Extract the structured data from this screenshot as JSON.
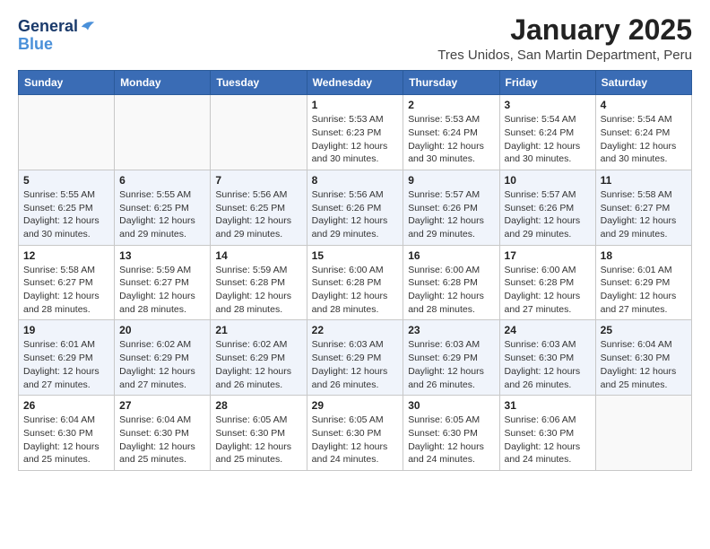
{
  "logo": {
    "line1": "General",
    "line2": "Blue"
  },
  "title": "January 2025",
  "subtitle": "Tres Unidos, San Martin Department, Peru",
  "days_header": [
    "Sunday",
    "Monday",
    "Tuesday",
    "Wednesday",
    "Thursday",
    "Friday",
    "Saturday"
  ],
  "weeks": [
    [
      {
        "day": "",
        "info": ""
      },
      {
        "day": "",
        "info": ""
      },
      {
        "day": "",
        "info": ""
      },
      {
        "day": "1",
        "info": "Sunrise: 5:53 AM\nSunset: 6:23 PM\nDaylight: 12 hours\nand 30 minutes."
      },
      {
        "day": "2",
        "info": "Sunrise: 5:53 AM\nSunset: 6:24 PM\nDaylight: 12 hours\nand 30 minutes."
      },
      {
        "day": "3",
        "info": "Sunrise: 5:54 AM\nSunset: 6:24 PM\nDaylight: 12 hours\nand 30 minutes."
      },
      {
        "day": "4",
        "info": "Sunrise: 5:54 AM\nSunset: 6:24 PM\nDaylight: 12 hours\nand 30 minutes."
      }
    ],
    [
      {
        "day": "5",
        "info": "Sunrise: 5:55 AM\nSunset: 6:25 PM\nDaylight: 12 hours\nand 30 minutes."
      },
      {
        "day": "6",
        "info": "Sunrise: 5:55 AM\nSunset: 6:25 PM\nDaylight: 12 hours\nand 29 minutes."
      },
      {
        "day": "7",
        "info": "Sunrise: 5:56 AM\nSunset: 6:25 PM\nDaylight: 12 hours\nand 29 minutes."
      },
      {
        "day": "8",
        "info": "Sunrise: 5:56 AM\nSunset: 6:26 PM\nDaylight: 12 hours\nand 29 minutes."
      },
      {
        "day": "9",
        "info": "Sunrise: 5:57 AM\nSunset: 6:26 PM\nDaylight: 12 hours\nand 29 minutes."
      },
      {
        "day": "10",
        "info": "Sunrise: 5:57 AM\nSunset: 6:26 PM\nDaylight: 12 hours\nand 29 minutes."
      },
      {
        "day": "11",
        "info": "Sunrise: 5:58 AM\nSunset: 6:27 PM\nDaylight: 12 hours\nand 29 minutes."
      }
    ],
    [
      {
        "day": "12",
        "info": "Sunrise: 5:58 AM\nSunset: 6:27 PM\nDaylight: 12 hours\nand 28 minutes."
      },
      {
        "day": "13",
        "info": "Sunrise: 5:59 AM\nSunset: 6:27 PM\nDaylight: 12 hours\nand 28 minutes."
      },
      {
        "day": "14",
        "info": "Sunrise: 5:59 AM\nSunset: 6:28 PM\nDaylight: 12 hours\nand 28 minutes."
      },
      {
        "day": "15",
        "info": "Sunrise: 6:00 AM\nSunset: 6:28 PM\nDaylight: 12 hours\nand 28 minutes."
      },
      {
        "day": "16",
        "info": "Sunrise: 6:00 AM\nSunset: 6:28 PM\nDaylight: 12 hours\nand 28 minutes."
      },
      {
        "day": "17",
        "info": "Sunrise: 6:00 AM\nSunset: 6:28 PM\nDaylight: 12 hours\nand 27 minutes."
      },
      {
        "day": "18",
        "info": "Sunrise: 6:01 AM\nSunset: 6:29 PM\nDaylight: 12 hours\nand 27 minutes."
      }
    ],
    [
      {
        "day": "19",
        "info": "Sunrise: 6:01 AM\nSunset: 6:29 PM\nDaylight: 12 hours\nand 27 minutes."
      },
      {
        "day": "20",
        "info": "Sunrise: 6:02 AM\nSunset: 6:29 PM\nDaylight: 12 hours\nand 27 minutes."
      },
      {
        "day": "21",
        "info": "Sunrise: 6:02 AM\nSunset: 6:29 PM\nDaylight: 12 hours\nand 26 minutes."
      },
      {
        "day": "22",
        "info": "Sunrise: 6:03 AM\nSunset: 6:29 PM\nDaylight: 12 hours\nand 26 minutes."
      },
      {
        "day": "23",
        "info": "Sunrise: 6:03 AM\nSunset: 6:29 PM\nDaylight: 12 hours\nand 26 minutes."
      },
      {
        "day": "24",
        "info": "Sunrise: 6:03 AM\nSunset: 6:30 PM\nDaylight: 12 hours\nand 26 minutes."
      },
      {
        "day": "25",
        "info": "Sunrise: 6:04 AM\nSunset: 6:30 PM\nDaylight: 12 hours\nand 25 minutes."
      }
    ],
    [
      {
        "day": "26",
        "info": "Sunrise: 6:04 AM\nSunset: 6:30 PM\nDaylight: 12 hours\nand 25 minutes."
      },
      {
        "day": "27",
        "info": "Sunrise: 6:04 AM\nSunset: 6:30 PM\nDaylight: 12 hours\nand 25 minutes."
      },
      {
        "day": "28",
        "info": "Sunrise: 6:05 AM\nSunset: 6:30 PM\nDaylight: 12 hours\nand 25 minutes."
      },
      {
        "day": "29",
        "info": "Sunrise: 6:05 AM\nSunset: 6:30 PM\nDaylight: 12 hours\nand 24 minutes."
      },
      {
        "day": "30",
        "info": "Sunrise: 6:05 AM\nSunset: 6:30 PM\nDaylight: 12 hours\nand 24 minutes."
      },
      {
        "day": "31",
        "info": "Sunrise: 6:06 AM\nSunset: 6:30 PM\nDaylight: 12 hours\nand 24 minutes."
      },
      {
        "day": "",
        "info": ""
      }
    ]
  ]
}
